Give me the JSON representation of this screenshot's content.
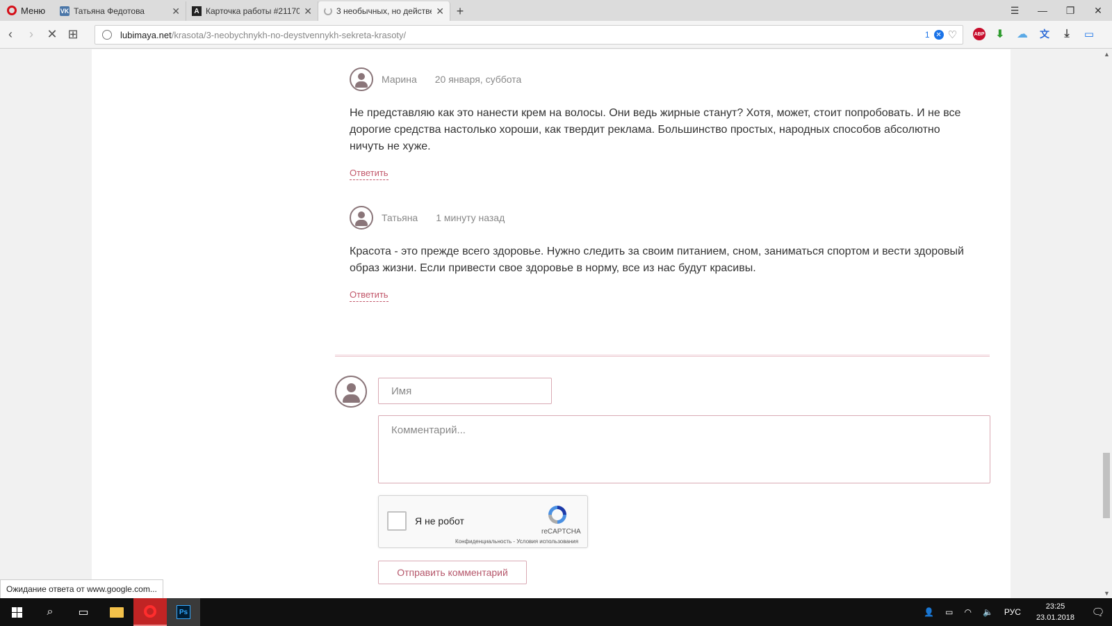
{
  "browser": {
    "menu_label": "Меню",
    "tabs": [
      {
        "title": "Татьяна Федотова",
        "favicon": "vk-icon"
      },
      {
        "title": "Карточка работы #21170",
        "favicon": "a-icon"
      },
      {
        "title": "3 необычных, но действе",
        "favicon": "loading-icon"
      }
    ],
    "url_host": "lubimaya.net",
    "url_path": "/krasota/3-neobychnykh-no-deystvennykh-sekreta-krasoty/",
    "blocked_count": "1",
    "abp_label": "ABP"
  },
  "comments": [
    {
      "author": "Марина",
      "date": "20 января, суббота",
      "text": "Не представляю как это нанести крем на волосы. Они ведь жирные станут? Хотя, может, стоит попробовать. И не все дорогие средства настолько хороши, как твердит реклама. Большинство простых, народных способов абсолютно ничуть не хуже.",
      "reply_label": "Ответить"
    },
    {
      "author": "Татьяна",
      "date": "1 минуту назад",
      "text": "Красота - это прежде всего здоровье. Нужно следить за своим питанием, сном, заниматься спортом и вести здоровый образ жизни. Если привести свое здоровье в норму, все из нас будут красивы.",
      "reply_label": "Ответить"
    }
  ],
  "form": {
    "name_placeholder": "Имя",
    "comment_placeholder": "Комментарий...",
    "captcha_label": "Я не робот",
    "captcha_brand": "reCAPTCHA",
    "captcha_terms": "Конфиденциальность - Условия использования",
    "submit_label": "Отправить комментарий"
  },
  "status_text": "Ожидание ответа от www.google.com...",
  "taskbar": {
    "language": "РУС",
    "time": "23:25",
    "date": "23.01.2018"
  },
  "colors": {
    "accent": "#c2586b",
    "avatar": "#8a7579",
    "border": "#d9a9b3"
  }
}
